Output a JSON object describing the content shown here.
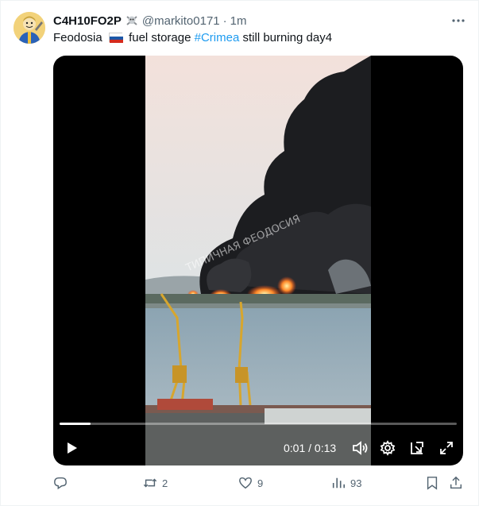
{
  "author": {
    "display_name": "C4H10FO2P",
    "handle": "@markito0171",
    "separator": "·",
    "timestamp": "1m"
  },
  "tweet": {
    "text_part1": "Feodosia",
    "flag": "russia-flag",
    "text_part2": "fuel storage",
    "hashtag": "#Crimea",
    "text_part3": "still burning day4"
  },
  "video": {
    "watermark": "ТИПИЧНАЯ ФЕОДОСИЯ",
    "time_display": "0:01 / 0:13",
    "progress": 0.077
  },
  "actions": {
    "reply_count": "",
    "retweet_count": "2",
    "like_count": "9",
    "views_count": "93"
  },
  "colors": {
    "accent": "#1d9bf0",
    "secondary_text": "#536471"
  }
}
